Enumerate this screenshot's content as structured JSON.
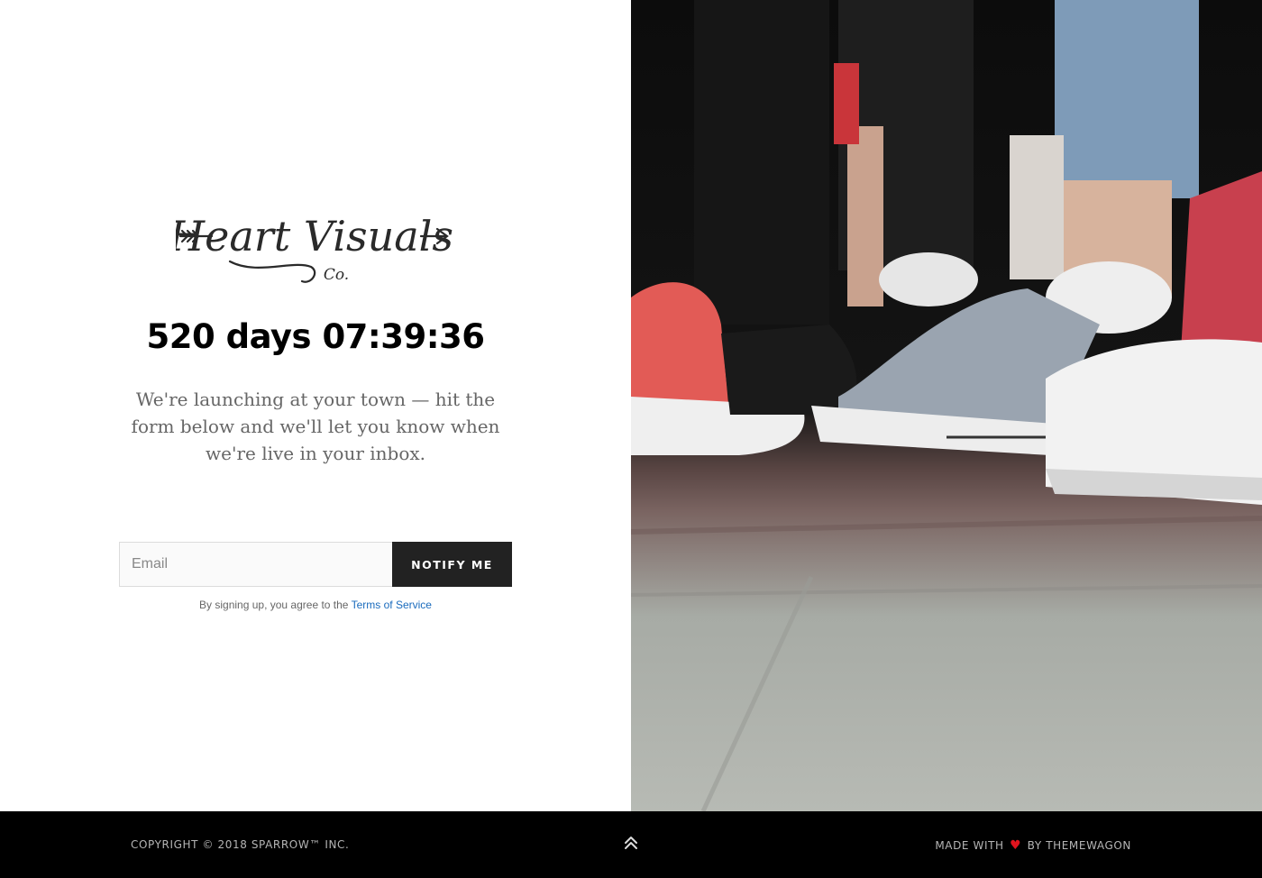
{
  "brand": {
    "logo_text": "Heart Visuals",
    "logo_sub": "Co."
  },
  "countdown": {
    "text": "520 days 07:39:36"
  },
  "tagline": "We're launching at your town — hit the form below and we'll let you know when we're live in your inbox.",
  "form": {
    "email_placeholder": "Email",
    "email_value": "",
    "button_label": "NOTIFY ME",
    "terms_prefix": "By signing up, you agree to the",
    "terms_link": "Terms of Service"
  },
  "footer": {
    "copyright": "COPYRIGHT © 2018 SPARROW™ INC.",
    "made_with_prefix": "MADE WITH",
    "made_with_suffix": "BY THEMEWAGON",
    "heart_icon": "heart-icon",
    "scroll_icon": "double-chevron-up-icon"
  },
  "colors": {
    "accent_button": "#222222",
    "link": "#1a6bbd",
    "heart": "#e0141e",
    "footer_bg": "#000000"
  }
}
